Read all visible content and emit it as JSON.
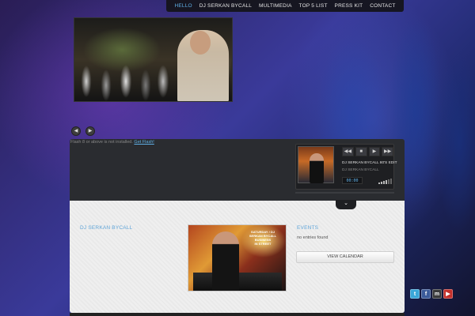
{
  "nav": {
    "items": [
      {
        "label": "HELLO",
        "active": true
      },
      {
        "label": "DJ SERKAN BYCALL",
        "active": false
      },
      {
        "label": "MULTIMEDIA",
        "active": false
      },
      {
        "label": "TOP 5 LIST",
        "active": false
      },
      {
        "label": "PRESS KIT",
        "active": false
      },
      {
        "label": "CONTACT",
        "active": false
      }
    ]
  },
  "slider": {
    "prev_icon": "chevron-left-icon",
    "next_icon": "chevron-right-icon"
  },
  "flash": {
    "message": "Flash 8 or above is not installed.",
    "link": "Get Flash!"
  },
  "player": {
    "track_title": "DJ SERKAN BYCALL 80'S EDIT",
    "artist": "DJ SERKAN BYCALL",
    "time": "00:00",
    "controls": [
      "rewind-icon",
      "stop-icon",
      "play-icon",
      "fast-forward-icon"
    ]
  },
  "content": {
    "left_title": "DJ SERKAN BYCALL",
    "events_title": "EVENTS",
    "no_entries": "no entries found",
    "view_calendar": "VIEW CALENDAR",
    "poster_text": "SATURDAY / DJ\nSERKAN BYCALL\nBUSINESS\nIN STREET"
  },
  "social": [
    "twitter-icon",
    "facebook-icon",
    "myspace-icon",
    "youtube-icon"
  ],
  "colors": {
    "accent": "#5fb0e6",
    "nav_bg": "#141418",
    "panel_dark": "#2a2c30",
    "panel_light": "#efefef"
  }
}
